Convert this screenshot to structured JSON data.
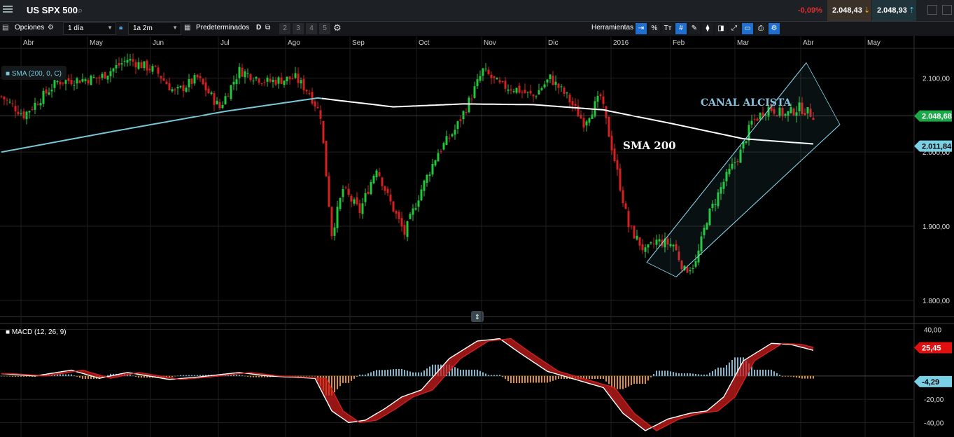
{
  "header": {
    "instrument": "US SPX 500",
    "change_pct": "-0,09%",
    "bid": "2.048,43",
    "ask": "2.048,93"
  },
  "toolbar": {
    "options_label": "Opciones",
    "interval": "1 día",
    "range": "1a 2m",
    "presets_label": "Predeterminados",
    "d_label": "D",
    "layout_tabs": [
      "2",
      "3",
      "4",
      "5"
    ],
    "tools_label": "Herramientas",
    "tools": [
      "⇥",
      "%",
      "Tт",
      "#",
      "✎",
      "⧫",
      "◨",
      "⤢",
      "▭",
      "⎙",
      "⚙"
    ]
  },
  "colors": {
    "background": "#000000",
    "up": "#22c83a",
    "down": "#d42020",
    "sma": "#78c8d8",
    "sma200": "#ffffff",
    "channel": "#8ad4e8",
    "macd_pos_hist": "#7ab8d0",
    "macd_neg_hist": "#e0902a",
    "last_price_tag": "#1aa848",
    "sma_tag": "#7ad0e4",
    "macd_tag": "#e01010"
  },
  "chart_data": [
    {
      "type": "candlestick",
      "title": "US SPX 500",
      "x_labels": [
        "Abr",
        "May",
        "Jun",
        "Jul",
        "Ago",
        "Sep",
        "Oct",
        "Nov",
        "Dic",
        "2016",
        "Feb",
        "Mar",
        "Abr",
        "May"
      ],
      "ylim": [
        1780,
        2140
      ],
      "y_ticks": [
        "2.100,00",
        "2.000,00",
        "1.900,00",
        "1.800,00"
      ],
      "y_tick_values": [
        2100,
        2000,
        1900,
        1800
      ],
      "indicator_legend": "SMA (200, 0, C)",
      "annotations": [
        "CANAL ALCISTA",
        "SMA 200"
      ],
      "last_price_tag": "2.048,68",
      "last_price": 2048.68,
      "sma_tag": "2.011,84",
      "sma_value": 2011.84,
      "close_keypoints": [
        {
          "i": 0,
          "v": 2075
        },
        {
          "i": 8,
          "v": 2050
        },
        {
          "i": 20,
          "v": 2095
        },
        {
          "i": 35,
          "v": 2100
        },
        {
          "i": 45,
          "v": 2125
        },
        {
          "i": 55,
          "v": 2110
        },
        {
          "i": 62,
          "v": 2080
        },
        {
          "i": 70,
          "v": 2100
        },
        {
          "i": 78,
          "v": 2060
        },
        {
          "i": 85,
          "v": 2110
        },
        {
          "i": 95,
          "v": 2095
        },
        {
          "i": 105,
          "v": 2100
        },
        {
          "i": 110,
          "v": 2080
        },
        {
          "i": 114,
          "v": 2050
        },
        {
          "i": 118,
          "v": 1890
        },
        {
          "i": 122,
          "v": 1950
        },
        {
          "i": 128,
          "v": 1920
        },
        {
          "i": 134,
          "v": 1980
        },
        {
          "i": 138,
          "v": 1940
        },
        {
          "i": 144,
          "v": 1890
        },
        {
          "i": 150,
          "v": 1950
        },
        {
          "i": 156,
          "v": 2000
        },
        {
          "i": 162,
          "v": 2030
        },
        {
          "i": 166,
          "v": 2060
        },
        {
          "i": 172,
          "v": 2110
        },
        {
          "i": 178,
          "v": 2090
        },
        {
          "i": 184,
          "v": 2085
        },
        {
          "i": 190,
          "v": 2075
        },
        {
          "i": 196,
          "v": 2100
        },
        {
          "i": 202,
          "v": 2075
        },
        {
          "i": 208,
          "v": 2040
        },
        {
          "i": 214,
          "v": 2075
        },
        {
          "i": 219,
          "v": 1990
        },
        {
          "i": 224,
          "v": 1900
        },
        {
          "i": 230,
          "v": 1865
        },
        {
          "i": 234,
          "v": 1880
        },
        {
          "i": 240,
          "v": 1875
        },
        {
          "i": 244,
          "v": 1840
        },
        {
          "i": 248,
          "v": 1850
        },
        {
          "i": 252,
          "v": 1910
        },
        {
          "i": 258,
          "v": 1960
        },
        {
          "i": 264,
          "v": 2000
        },
        {
          "i": 268,
          "v": 2040
        },
        {
          "i": 274,
          "v": 2060
        },
        {
          "i": 280,
          "v": 2050
        },
        {
          "i": 285,
          "v": 2060
        },
        {
          "i": 290,
          "v": 2050
        }
      ],
      "sma200_keypoints": [
        {
          "i": 0,
          "v": 2000
        },
        {
          "i": 40,
          "v": 2028
        },
        {
          "i": 80,
          "v": 2055
        },
        {
          "i": 113,
          "v": 2073
        },
        {
          "i": 140,
          "v": 2061
        },
        {
          "i": 165,
          "v": 2065
        },
        {
          "i": 190,
          "v": 2064
        },
        {
          "i": 215,
          "v": 2057
        },
        {
          "i": 240,
          "v": 2038
        },
        {
          "i": 265,
          "v": 2018
        },
        {
          "i": 290,
          "v": 2011
        }
      ],
      "channel": {
        "lower": [
          [
            236,
            1860
          ],
          [
            290,
            1990
          ]
        ],
        "upper": [
          [
            236,
            1872
          ],
          [
            290,
            2130
          ]
        ]
      }
    },
    {
      "type": "macd",
      "indicator_legend": "MACD (12, 26, 9)",
      "ylim": [
        -50,
        45
      ],
      "y_ticks": [
        "40,00",
        "-20,00",
        "-40,00"
      ],
      "y_tick_values": [
        40,
        -20,
        -40
      ],
      "macd_tag": "25,45",
      "macd_value": 25.45,
      "hist_tag": "-4,29",
      "hist_value": -4.29,
      "macd_keypoints": [
        {
          "i": 0,
          "v": 2
        },
        {
          "i": 12,
          "v": 0
        },
        {
          "i": 25,
          "v": 5
        },
        {
          "i": 35,
          "v": -2
        },
        {
          "i": 45,
          "v": 3
        },
        {
          "i": 60,
          "v": -3
        },
        {
          "i": 70,
          "v": -1
        },
        {
          "i": 85,
          "v": 3
        },
        {
          "i": 95,
          "v": 0
        },
        {
          "i": 112,
          "v": -2
        },
        {
          "i": 118,
          "v": -30
        },
        {
          "i": 124,
          "v": -40
        },
        {
          "i": 130,
          "v": -38
        },
        {
          "i": 137,
          "v": -28
        },
        {
          "i": 143,
          "v": -18
        },
        {
          "i": 150,
          "v": -12
        },
        {
          "i": 160,
          "v": 15
        },
        {
          "i": 170,
          "v": 30
        },
        {
          "i": 178,
          "v": 32
        },
        {
          "i": 185,
          "v": 20
        },
        {
          "i": 195,
          "v": 4
        },
        {
          "i": 205,
          "v": -3
        },
        {
          "i": 215,
          "v": -10
        },
        {
          "i": 222,
          "v": -32
        },
        {
          "i": 230,
          "v": -47
        },
        {
          "i": 238,
          "v": -37
        },
        {
          "i": 246,
          "v": -32
        },
        {
          "i": 252,
          "v": -30
        },
        {
          "i": 258,
          "v": -18
        },
        {
          "i": 265,
          "v": 13
        },
        {
          "i": 275,
          "v": 28
        },
        {
          "i": 282,
          "v": 27
        },
        {
          "i": 290,
          "v": 22
        }
      ],
      "signal_lag": 4
    }
  ]
}
